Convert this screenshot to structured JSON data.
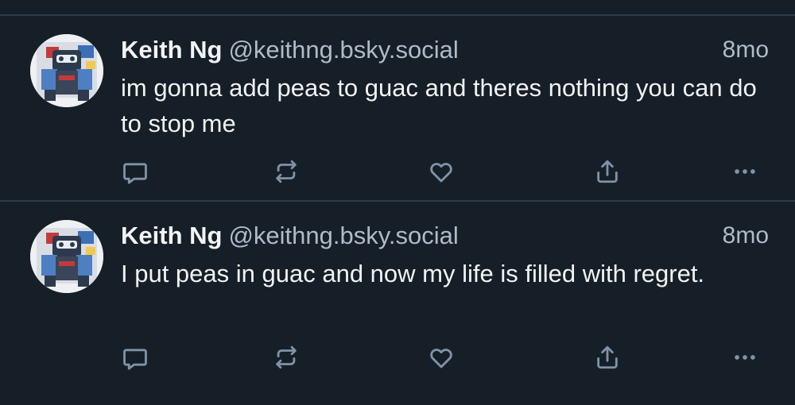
{
  "colors": {
    "background": "#161e27",
    "divider": "#2c3a4a",
    "text_primary": "#f1f3f5",
    "text_secondary": "#aebbc9",
    "icon": "#7f93a8"
  },
  "posts": [
    {
      "author": {
        "display_name": "Keith Ng",
        "handle": "@keithng.bsky.social",
        "avatar": "robot-mech-avatar"
      },
      "time": "8mo",
      "text": "im gonna add peas to guac and theres nothing you can do to stop me",
      "actions": [
        "reply-icon",
        "repost-icon",
        "like-icon",
        "share-icon",
        "more-icon"
      ]
    },
    {
      "author": {
        "display_name": "Keith Ng",
        "handle": "@keithng.bsky.social",
        "avatar": "robot-mech-avatar"
      },
      "time": "8mo",
      "text": "I put peas in guac and now my life is filled with regret.",
      "actions": [
        "reply-icon",
        "repost-icon",
        "like-icon",
        "share-icon",
        "more-icon"
      ]
    }
  ]
}
